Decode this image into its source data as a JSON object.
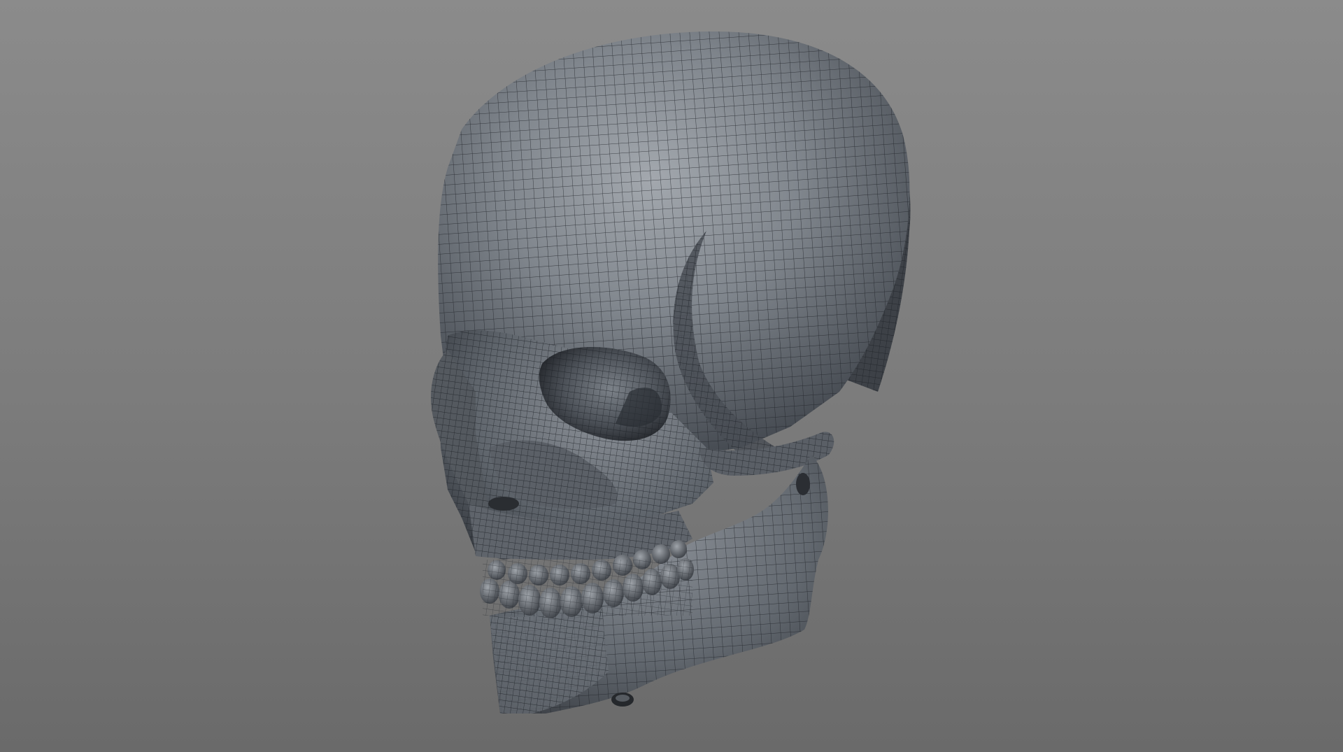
{
  "viewport": {
    "background_top": "#8b8b8b",
    "background_bottom": "#6a6a6a"
  },
  "model": {
    "mesh_fill_light": "#a3a8ae",
    "mesh_fill_mid": "#6a7077",
    "mesh_fill_dark": "#2e3238",
    "wire_color": "#1c1f24"
  }
}
